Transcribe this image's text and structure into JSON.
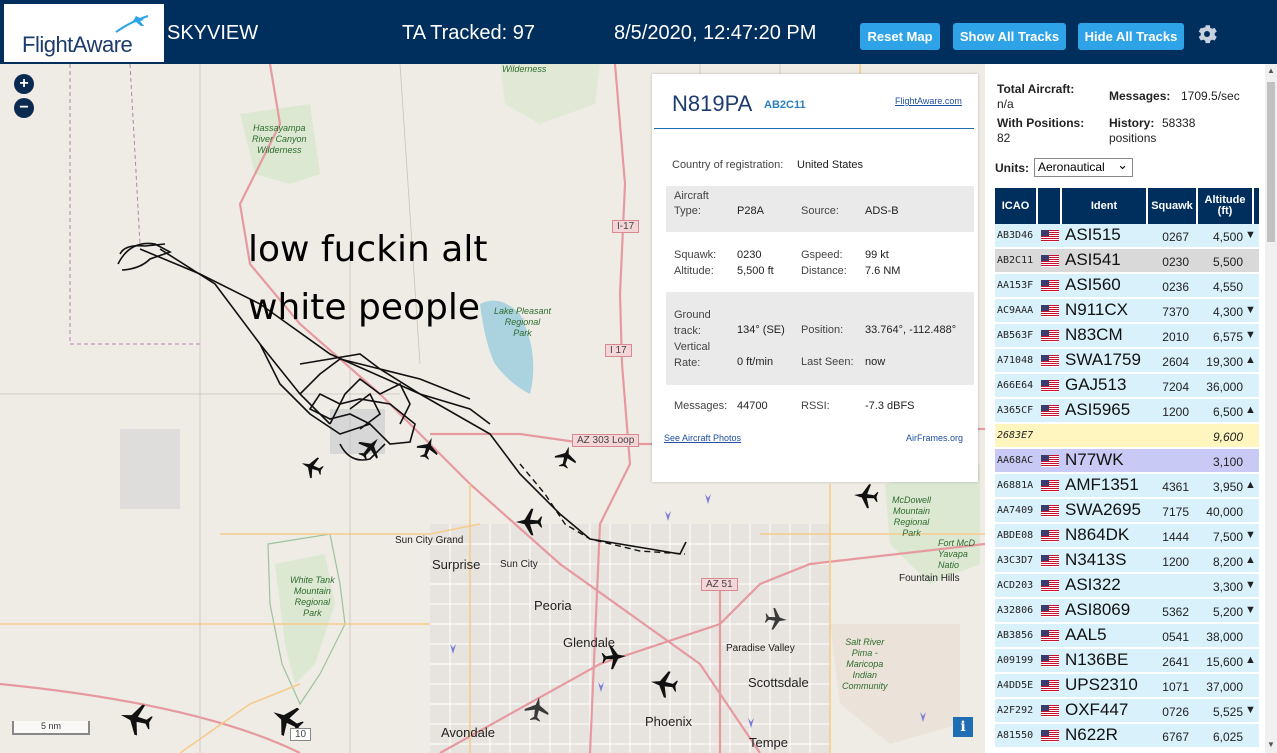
{
  "header": {
    "brand": "FlightAware",
    "title": "SKYVIEW",
    "tracked": "TA Tracked: 97",
    "datetime": "8/5/2020, 12:47:20 PM",
    "reset_label": "Reset Map",
    "show_label": "Show All Tracks",
    "hide_label": "Hide All Tracks"
  },
  "map": {
    "zoom_in": "+",
    "zoom_out": "−",
    "scale_label": "5 nm",
    "overlay_line1": "low fuckin alt",
    "overlay_line2": "white people",
    "parks": [
      {
        "name": "Wilderness"
      },
      {
        "name": "Hassayampa\nRiver Canyon\nWilderness"
      },
      {
        "name": "Lake Pleasant\nRegional\nPark"
      },
      {
        "name": "White Tank\nMountain\nRegional\nPark"
      },
      {
        "name": "McDowell\nMountain\nRegional\nPark"
      },
      {
        "name": "Salt River\nPima -\nMaricopa\nIndian\nCommunity"
      },
      {
        "name": "Fort McD\nYavapa\nNatio"
      }
    ],
    "places": [
      "Sun City Grand",
      "Sun City",
      "Fountain Hills",
      "Paradise Valley"
    ],
    "cities": [
      "Surprise",
      "Peoria",
      "Glendale",
      "Scottsdale",
      "Phoenix",
      "Avondale",
      "Tempe"
    ],
    "highways": [
      "I-17",
      "I 17",
      "AZ 303 Loop",
      "AZ 51",
      "10"
    ],
    "info": "i"
  },
  "popup": {
    "ident": "N819PA",
    "icao": "AB2C11",
    "fa_link": "FlightAware.com",
    "country_label": "Country of registration:",
    "country": "United States",
    "aircraft_type_label": "Aircraft\nType:",
    "aircraft_type": "P28A",
    "source_label": "Source:",
    "source": "ADS-B",
    "squawk_label": "Squawk:",
    "squawk": "0230",
    "altitude_label": "Altitude:",
    "altitude": "5,500 ft",
    "gspeed_label": "Gspeed:",
    "gspeed": "99 kt",
    "distance_label": "Distance:",
    "distance": "7.6 NM",
    "track_label": "Ground\ntrack:",
    "track": "134° (SE)",
    "position_label": "Position:",
    "position": "33.764°, -112.488°",
    "vrate_label": "Vertical\nRate:",
    "vrate": "0 ft/min",
    "lastseen_label": "Last Seen:",
    "lastseen": "now",
    "messages_label": "Messages:",
    "messages": "44700",
    "rssi_label": "RSSI:",
    "rssi": "-7.3 dBFS",
    "photos_link": "See Aircraft Photos",
    "airframes_link": "AirFrames.org"
  },
  "panel": {
    "total_label": "Total Aircraft:",
    "total_value": "n/a",
    "messages_label": "Messages:",
    "messages_value": "1709.5/sec",
    "positions_label": "With Positions:",
    "positions_value": "82",
    "history_label": "History:",
    "history_value": "58338",
    "history_unit": "positions",
    "units_label": "Units:",
    "units_value": "Aeronautical",
    "columns": [
      "ICAO",
      "Ident",
      "Squawk",
      "Altitude\n(ft)"
    ],
    "rows": [
      {
        "icao": "AB3D46",
        "flag": true,
        "ident": "ASI515",
        "squawk": "0267",
        "alt": "4,500",
        "trend": "▼"
      },
      {
        "icao": "AB2C11",
        "flag": true,
        "ident": "ASI541",
        "squawk": "0230",
        "alt": "5,500",
        "trend": ""
      },
      {
        "icao": "AA153F",
        "flag": true,
        "ident": "ASI560",
        "squawk": "0236",
        "alt": "4,550",
        "trend": ""
      },
      {
        "icao": "AC9AAA",
        "flag": true,
        "ident": "N911CX",
        "squawk": "7370",
        "alt": "4,300",
        "trend": "▼"
      },
      {
        "icao": "AB563F",
        "flag": true,
        "ident": "N83CM",
        "squawk": "2010",
        "alt": "6,575",
        "trend": "▼"
      },
      {
        "icao": "A71048",
        "flag": true,
        "ident": "SWA1759",
        "squawk": "2604",
        "alt": "19,300",
        "trend": "▲"
      },
      {
        "icao": "A66E64",
        "flag": true,
        "ident": "GAJ513",
        "squawk": "7204",
        "alt": "36,000",
        "trend": ""
      },
      {
        "icao": "A365CF",
        "flag": true,
        "ident": "ASI5965",
        "squawk": "1200",
        "alt": "6,500",
        "trend": "▲"
      },
      {
        "icao": "2683E7",
        "flag": false,
        "ident": "",
        "squawk": "",
        "alt": "9,600",
        "trend": ""
      },
      {
        "icao": "AA68AC",
        "flag": true,
        "ident": "N77WK",
        "squawk": "",
        "alt": "3,100",
        "trend": ""
      },
      {
        "icao": "A6881A",
        "flag": true,
        "ident": "AMF1351",
        "squawk": "4361",
        "alt": "3,950",
        "trend": "▲"
      },
      {
        "icao": "AA7409",
        "flag": true,
        "ident": "SWA2695",
        "squawk": "7175",
        "alt": "40,000",
        "trend": ""
      },
      {
        "icao": "ABDE08",
        "flag": true,
        "ident": "N864DK",
        "squawk": "1444",
        "alt": "7,500",
        "trend": "▼"
      },
      {
        "icao": "A3C3D7",
        "flag": true,
        "ident": "N3413S",
        "squawk": "1200",
        "alt": "8,200",
        "trend": "▲"
      },
      {
        "icao": "ACD203",
        "flag": true,
        "ident": "ASI322",
        "squawk": "",
        "alt": "3,300",
        "trend": "▼"
      },
      {
        "icao": "A32806",
        "flag": true,
        "ident": "ASI8069",
        "squawk": "5362",
        "alt": "5,200",
        "trend": "▼"
      },
      {
        "icao": "AB3856",
        "flag": true,
        "ident": "AAL5",
        "squawk": "0541",
        "alt": "38,000",
        "trend": ""
      },
      {
        "icao": "A09199",
        "flag": true,
        "ident": "N136BE",
        "squawk": "2641",
        "alt": "15,600",
        "trend": "▲"
      },
      {
        "icao": "A4DD5E",
        "flag": true,
        "ident": "UPS2310",
        "squawk": "1071",
        "alt": "37,000",
        "trend": ""
      },
      {
        "icao": "A2F292",
        "flag": true,
        "ident": "OXF447",
        "squawk": "0726",
        "alt": "5,525",
        "trend": "▼"
      },
      {
        "icao": "A81550",
        "flag": true,
        "ident": "N622R",
        "squawk": "6767",
        "alt": "6,025",
        "trend": ""
      }
    ]
  },
  "colors": {
    "header_bg": "#002f5d",
    "button_bg": "#2ea3e8",
    "row_blue": "#d9f1fb",
    "row_selected": "#d9d9d9",
    "row_yellow": "#fff6bf",
    "row_purple": "#c9c9f5"
  }
}
